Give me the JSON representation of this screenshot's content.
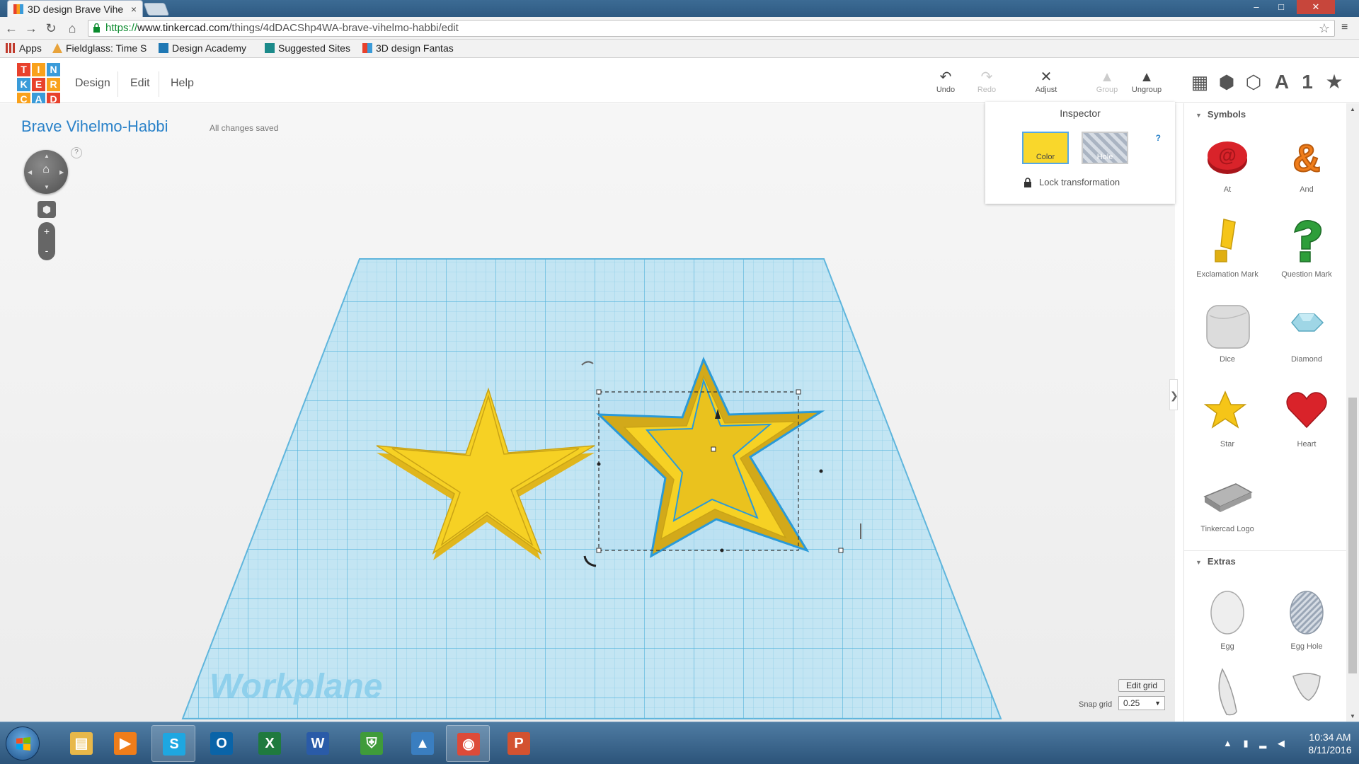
{
  "browser": {
    "tab_title": "3D design Brave Vihe",
    "tab_close": "×",
    "window_controls": {
      "minimize": "–",
      "maximize": "□",
      "close": "✕"
    },
    "url_scheme": "https://",
    "url_host": "www.tinkercad.com",
    "url_path": "/things/4dDACShp4WA-brave-vihelmo-habbi/edit",
    "nav": {
      "back": "←",
      "forward": "→",
      "reload": "↻",
      "home": "⌂"
    },
    "bookmark_star": "☆",
    "menu_icon": "≡",
    "bookmarks": [
      {
        "label": "Apps",
        "icon": "apps-grid-icon",
        "color": "#c0392b"
      },
      {
        "label": "Fieldglass: Time S",
        "icon": "fieldglass-icon",
        "color": "#e8a33b"
      },
      {
        "label": "Design Academy",
        "icon": "bing-icon",
        "color": "#1f78b4"
      },
      {
        "label": "Suggested Sites",
        "icon": "bing-icon",
        "color": "#1b8a8a"
      },
      {
        "label": "3D design Fantas",
        "icon": "tinkercad-icon",
        "color": "#e8412c"
      }
    ]
  },
  "tinkercad": {
    "logo_letters": [
      "T",
      "I",
      "N",
      "K",
      "E",
      "R",
      "C",
      "A",
      "D"
    ],
    "logo_colors": [
      "#e8412c",
      "#f9a11b",
      "#3a9bd9",
      "#3a9bd9",
      "#e8412c",
      "#f9a11b",
      "#f9a11b",
      "#3a9bd9",
      "#e8412c"
    ],
    "menu": [
      "Design",
      "Edit",
      "Help"
    ],
    "tools": {
      "undo": {
        "label": "Undo",
        "icon": "↶"
      },
      "redo": {
        "label": "Redo",
        "icon": "↷"
      },
      "adjust": {
        "label": "Adjust",
        "icon": "✕"
      },
      "group": {
        "label": "Group",
        "icon": "▲"
      },
      "ungroup": {
        "label": "Ungroup",
        "icon": "▲"
      }
    },
    "view_buttons": {
      "grid": "▦",
      "box": "⬢",
      "wireframe": "⬡",
      "text": "A",
      "number": "1",
      "star": "★"
    },
    "design_title": "Brave Vihelmo-Habbi",
    "save_status": "All changes saved",
    "nav_help": "?",
    "zoom_in": "+",
    "zoom_out": "-",
    "workplane_label": "Workplane",
    "inspector": {
      "title": "Inspector",
      "help": "?",
      "color_label": "Color",
      "hole_label": "Hole",
      "lock_label": "Lock transformation",
      "solid_color": "#f9d72b"
    },
    "edit_grid_label": "Edit grid",
    "snap_label": "Snap grid",
    "snap_value": "0.25",
    "snap_caret": "▼",
    "panel_toggle": "❯"
  },
  "shapes_panel": {
    "symbols_title": "Symbols",
    "extras_title": "Extras",
    "symbols": [
      {
        "label": "At",
        "color": "#d9232a"
      },
      {
        "label": "And",
        "color": "#f07d1a"
      },
      {
        "label": "Exclamation Mark",
        "color": "#f5c518"
      },
      {
        "label": "Question Mark",
        "color": "#2e9e3a"
      },
      {
        "label": "Dice",
        "color": "#e4e4e4"
      },
      {
        "label": "Diamond",
        "color": "#9fd6e6"
      },
      {
        "label": "Star",
        "color": "#f5c518"
      },
      {
        "label": "Heart",
        "color": "#d9232a"
      },
      {
        "label": "Tinkercad Logo",
        "color": "#9a9a9a"
      }
    ],
    "extras": [
      {
        "label": "Egg",
        "color": "#f0f0f0"
      },
      {
        "label": "Egg Hole",
        "color": "#aab4c2"
      }
    ]
  },
  "taskbar": {
    "apps": [
      {
        "name": "file-explorer",
        "color": "#e8b84a",
        "glyph": "▤"
      },
      {
        "name": "media-player",
        "color": "#f07d1a",
        "glyph": "▶"
      },
      {
        "name": "skype",
        "color": "#1ea7e1",
        "glyph": "S"
      },
      {
        "name": "outlook",
        "color": "#0a64a8",
        "glyph": "O"
      },
      {
        "name": "excel",
        "color": "#1f7a3e",
        "glyph": "X"
      },
      {
        "name": "word",
        "color": "#2a5ba8",
        "glyph": "W"
      },
      {
        "name": "security",
        "color": "#3f9b3a",
        "glyph": "⛨"
      },
      {
        "name": "autodesk",
        "color": "#3a7ec0",
        "glyph": "▲"
      },
      {
        "name": "chrome",
        "color": "#dd4b39",
        "glyph": "◉"
      },
      {
        "name": "powerpoint",
        "color": "#d35230",
        "glyph": "P"
      }
    ],
    "tray_icons": "▲ ▮ ▂ ◀",
    "time": "10:34 AM",
    "date": "8/11/2016"
  }
}
